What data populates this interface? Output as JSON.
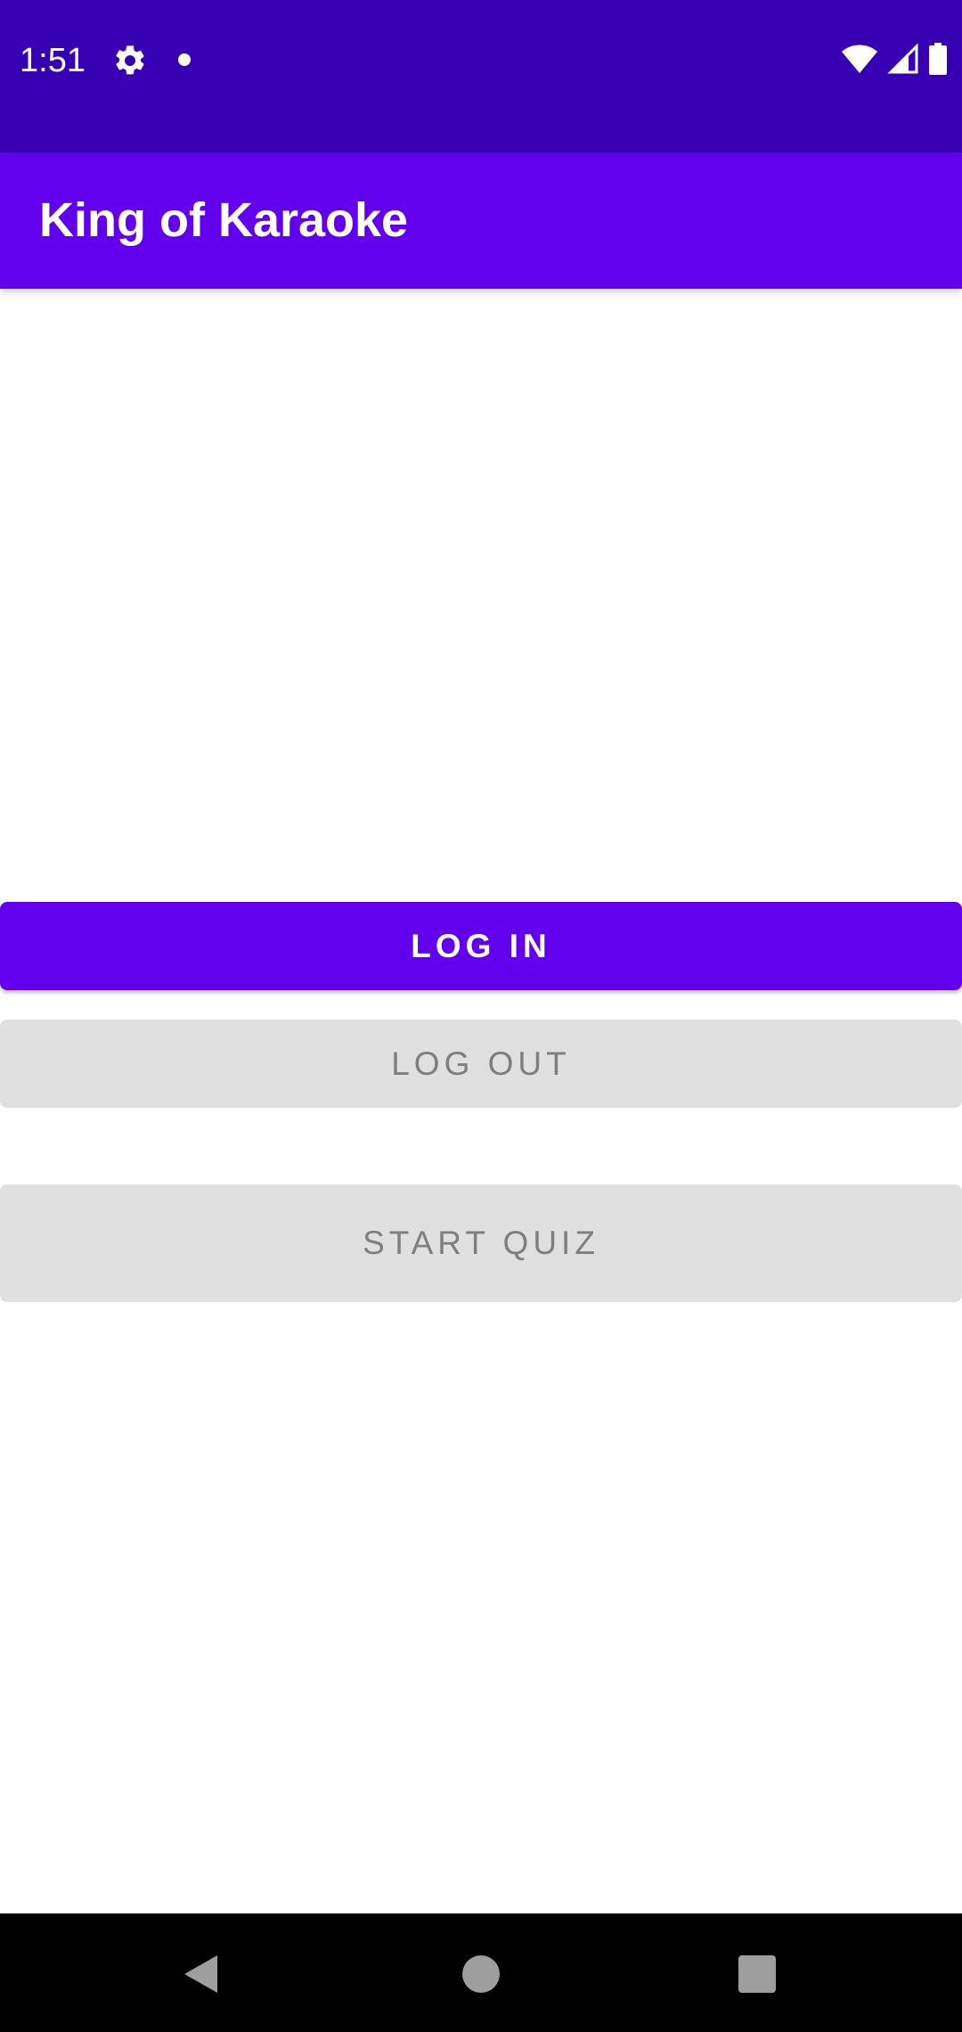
{
  "status_bar": {
    "time": "1:51",
    "icons": [
      "gear-icon",
      "notification-dot-icon",
      "wifi-icon",
      "signal-icon",
      "battery-icon"
    ]
  },
  "app_bar": {
    "title": "King of Karaoke"
  },
  "buttons": {
    "login": "LOG IN",
    "logout": "LOG OUT",
    "start_quiz": "START QUIZ"
  },
  "nav_bar": {
    "icons": [
      "back-icon",
      "home-icon",
      "recents-icon"
    ]
  },
  "colors": {
    "status_bar": "#3700b3",
    "primary": "#6200ee",
    "disabled_bg": "#e0e0e0",
    "disabled_text": "#7f7f7f"
  }
}
